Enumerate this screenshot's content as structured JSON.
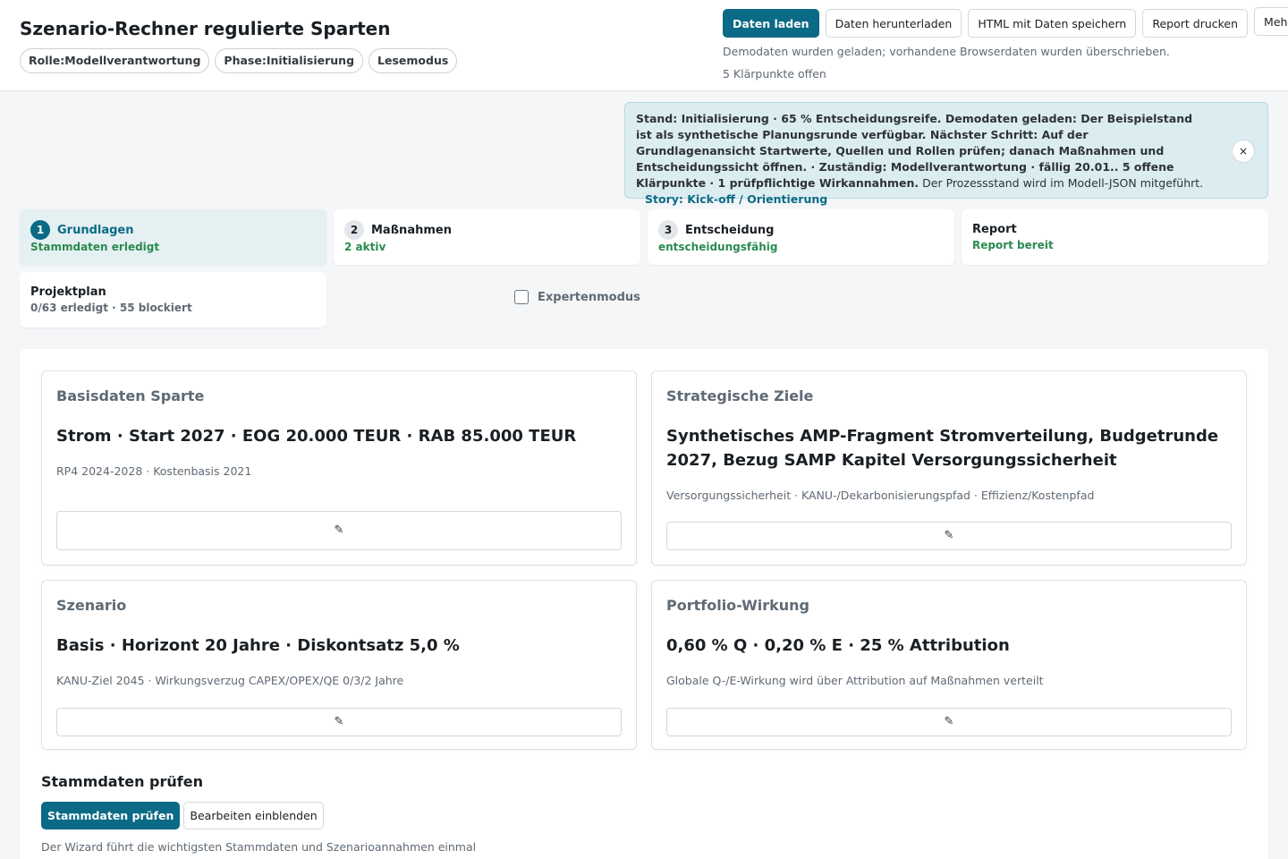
{
  "header": {
    "title": "Szenario-Rechner regulierte Sparten",
    "pills": [
      "Rolle:Modellverantwortung",
      "Phase:Initialisierung",
      "Lesemodus"
    ]
  },
  "toolbar": {
    "load": "Daten laden",
    "download": "Daten herunterladen",
    "save_html": "HTML mit Daten speichern",
    "print": "Report drucken",
    "more": "Mehr",
    "message": "Demodaten wurden geladen; vorhandene Browserdaten wurden überschrieben.",
    "open_points": "5 Klärpunkte offen"
  },
  "banner": {
    "bold_text": "Stand: Initialisierung · 65 % Entscheidungsreife. Demodaten geladen: Der Beispielstand ist als synthetische Planungsrunde verfügbar. Nächster Schritt: Auf der Grundlagenansicht Startwerte, Quellen und Rollen prüfen; danach Maßnahmen und Entscheidungssicht öffnen. · Zuständig: Modellverantwortung · fällig 20.01.. 5 offene Klärpunkte · 1 prüfpflichtige Wirkannahmen.",
    "plain_text": "Der Prozessstand wird im Modell-JSON mitgeführt.",
    "story_link": "Story: Kick-off / Orientierung",
    "close": "×"
  },
  "steps": [
    {
      "num": "1",
      "title": "Grundlagen",
      "sub": "Stammdaten erledigt"
    },
    {
      "num": "2",
      "title": "Maßnahmen",
      "sub": "2 aktiv"
    },
    {
      "num": "3",
      "title": "Entscheidung",
      "sub": "entscheidungsfähig"
    },
    {
      "title": "Report",
      "sub": "Report bereit"
    },
    {
      "title": "Projektplan",
      "sub": "0/63 erledigt · 55 blockiert"
    }
  ],
  "expert_mode": "Expertenmodus",
  "cards": [
    {
      "label": "Basisdaten Sparte",
      "value": "Strom · Start 2027 · EOG 20.000 TEUR · RAB 85.000 TEUR",
      "meta": "RP4 2024-2028 · Kostenbasis 2021",
      "edit": "✎"
    },
    {
      "label": "Strategische Ziele",
      "value": "Synthetisches AMP-Fragment Stromverteilung, Budgetrunde 2027, Bezug SAMP Kapitel Versorgungssicherheit",
      "meta": "Versorgungssicherheit · KANU-/Dekarbonisierungspfad · Effizienz/Kostenpfad",
      "edit": "✎"
    },
    {
      "label": "Szenario",
      "value": "Basis · Horizont 20 Jahre · Diskontsatz 5,0 %",
      "meta": "KANU-Ziel 2045 · Wirkungsverzug CAPEX/OPEX/QE 0/3/2 Jahre",
      "edit": "✎"
    },
    {
      "label": "Portfolio-Wirkung",
      "value": "0,60 % Q · 0,20 % E · 25 % Attribution",
      "meta": "Globale Q-/E-Wirkung wird über Attribution auf Maßnahmen verteilt",
      "edit": "✎"
    }
  ],
  "section": {
    "title": "Stammdaten prüfen",
    "check_button": "Stammdaten prüfen",
    "edit_button": "Bearbeiten einblenden",
    "text": "Der Wizard führt die wichtigsten Stammdaten und Szenarioannahmen einmal"
  }
}
